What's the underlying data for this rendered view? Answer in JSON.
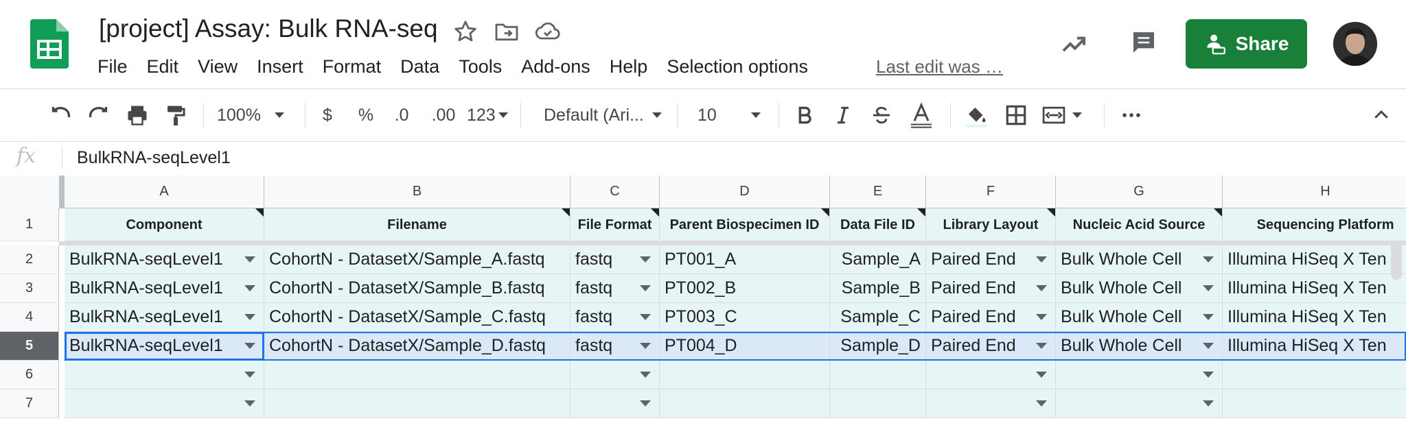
{
  "app": {
    "title": "[project] Assay: Bulk RNA-seq",
    "last_edit": "Last edit was …",
    "share_label": "Share",
    "accent": "#188038"
  },
  "menu": [
    "File",
    "Edit",
    "View",
    "Insert",
    "Format",
    "Data",
    "Tools",
    "Add-ons",
    "Help",
    "Selection options"
  ],
  "toolbar": {
    "zoom": "100%",
    "currency": "$",
    "percent": "%",
    "dec_decrease": ".0",
    "dec_increase": ".00",
    "more_formats": "123",
    "font": "Default (Ari...",
    "font_size": "10"
  },
  "formula_bar": {
    "fx": "fx",
    "value": "BulkRNA-seqLevel1"
  },
  "sheet": {
    "columns": [
      "A",
      "B",
      "C",
      "D",
      "E",
      "F",
      "G",
      "H"
    ],
    "row_numbers": [
      "1",
      "2",
      "3",
      "4",
      "5",
      "6",
      "7"
    ],
    "selected_row": 5,
    "headers": [
      "Component",
      "Filename",
      "File Format",
      "Parent Biospecimen ID",
      "Data File ID",
      "Library Layout",
      "Nucleic Acid Source",
      "Sequencing Platform"
    ],
    "rows": [
      [
        "BulkRNA-seqLevel1",
        "CohortN - DatasetX/Sample_A.fastq",
        "fastq",
        "PT001_A",
        "Sample_A",
        "Paired End",
        "Bulk Whole Cell",
        "Illumina HiSeq X Ten"
      ],
      [
        "BulkRNA-seqLevel1",
        "CohortN - DatasetX/Sample_B.fastq",
        "fastq",
        "PT002_B",
        "Sample_B",
        "Paired End",
        "Bulk Whole Cell",
        "Illumina HiSeq X Ten"
      ],
      [
        "BulkRNA-seqLevel1",
        "CohortN - DatasetX/Sample_C.fastq",
        "fastq",
        "PT003_C",
        "Sample_C",
        "Paired End",
        "Bulk Whole Cell",
        "Illumina HiSeq X Ten"
      ],
      [
        "BulkRNA-seqLevel1",
        "CohortN - DatasetX/Sample_D.fastq",
        "fastq",
        "PT004_D",
        "Sample_D",
        "Paired End",
        "Bulk Whole Cell",
        "Illumina HiSeq X Ten"
      ],
      [
        "",
        "",
        "",
        "",
        "",
        "",
        "",
        ""
      ],
      [
        "",
        "",
        "",
        "",
        "",
        "",
        "",
        ""
      ]
    ],
    "dropdown_columns": [
      0,
      2,
      5,
      6
    ],
    "colors": {
      "cell_fill": "#e8f5f6",
      "selection": "#1a73e8"
    }
  }
}
